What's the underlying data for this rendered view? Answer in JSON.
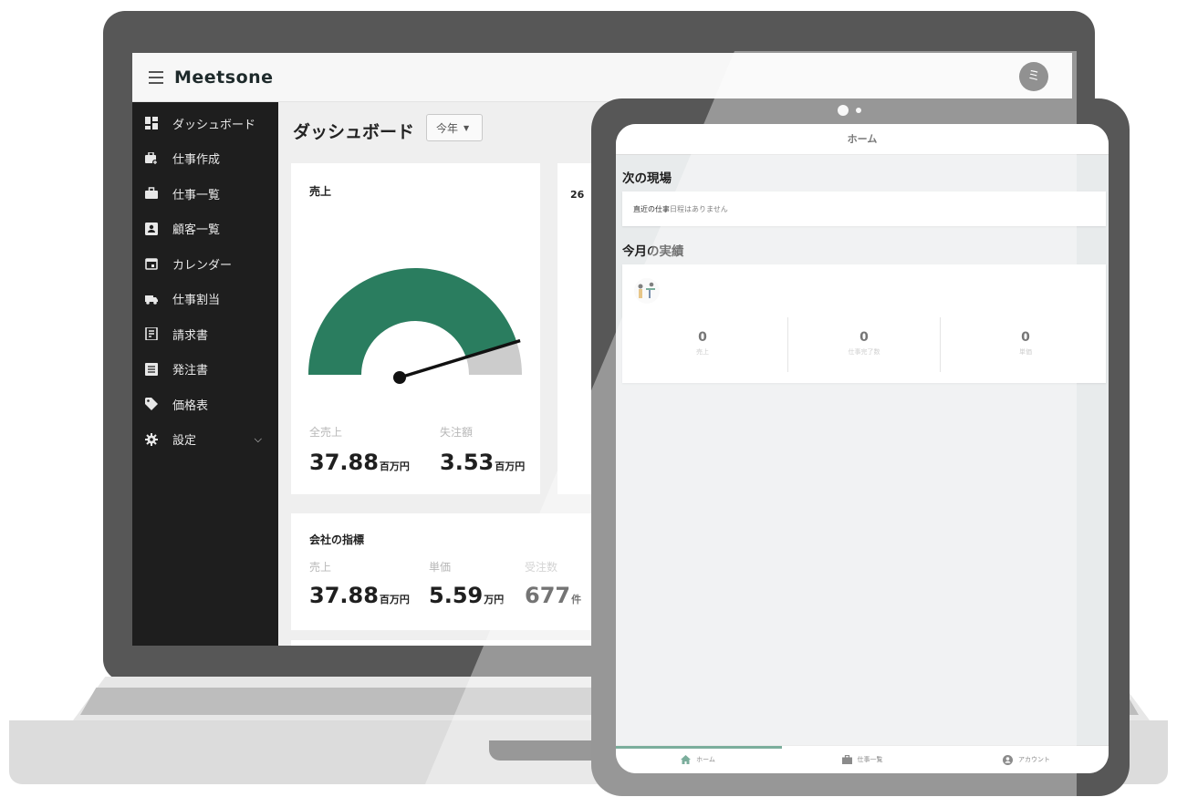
{
  "app": {
    "brand": "Meetsone",
    "user_initial": "ミ"
  },
  "sidebar": {
    "items": [
      {
        "label": "ダッシュボード",
        "icon": "dashboard-icon"
      },
      {
        "label": "仕事作成",
        "icon": "briefcase-plus-icon"
      },
      {
        "label": "仕事一覧",
        "icon": "briefcase-icon"
      },
      {
        "label": "顧客一覧",
        "icon": "contact-card-icon"
      },
      {
        "label": "カレンダー",
        "icon": "calendar-icon"
      },
      {
        "label": "仕事割当",
        "icon": "truck-icon"
      },
      {
        "label": "請求書",
        "icon": "receipt-icon"
      },
      {
        "label": "発注書",
        "icon": "list-document-icon"
      },
      {
        "label": "価格表",
        "icon": "tag-icon"
      },
      {
        "label": "設定",
        "icon": "gear-icon"
      }
    ]
  },
  "dashboard": {
    "title": "ダッシュボード",
    "period_select": "今年",
    "sales_card": {
      "title": "売上",
      "gauge_fraction": 0.9,
      "total_label": "全売上",
      "total_value": "37.88",
      "total_unit": "百万円",
      "lost_label": "失注額",
      "lost_value": "3.53",
      "lost_unit": "百万円"
    },
    "partial_card_text": "26",
    "kpi_card": {
      "title": "会社の指標",
      "metrics": [
        {
          "label": "売上",
          "value": "37.88",
          "unit": "百万円"
        },
        {
          "label": "単価",
          "value": "5.59",
          "unit": "万円"
        },
        {
          "label": "受注数",
          "value": "677",
          "unit": "件"
        }
      ]
    }
  },
  "tablet": {
    "header": "ホーム",
    "next_site_title": "次の現場",
    "next_site_empty": "直近の仕事日程はありません",
    "monthly_title": "今月の実績",
    "metrics": [
      {
        "value": "0",
        "label": "売上"
      },
      {
        "value": "0",
        "label": "仕事完了数"
      },
      {
        "value": "0",
        "label": "単価"
      }
    ],
    "nav": [
      {
        "label": "ホーム",
        "icon": "home-icon"
      },
      {
        "label": "仕事一覧",
        "icon": "briefcase-icon"
      },
      {
        "label": "アカウント",
        "icon": "account-icon"
      }
    ]
  },
  "colors": {
    "accent": "#2a7d5f",
    "sidebar_bg": "#1e1e1e",
    "device_frame": "#575757"
  }
}
